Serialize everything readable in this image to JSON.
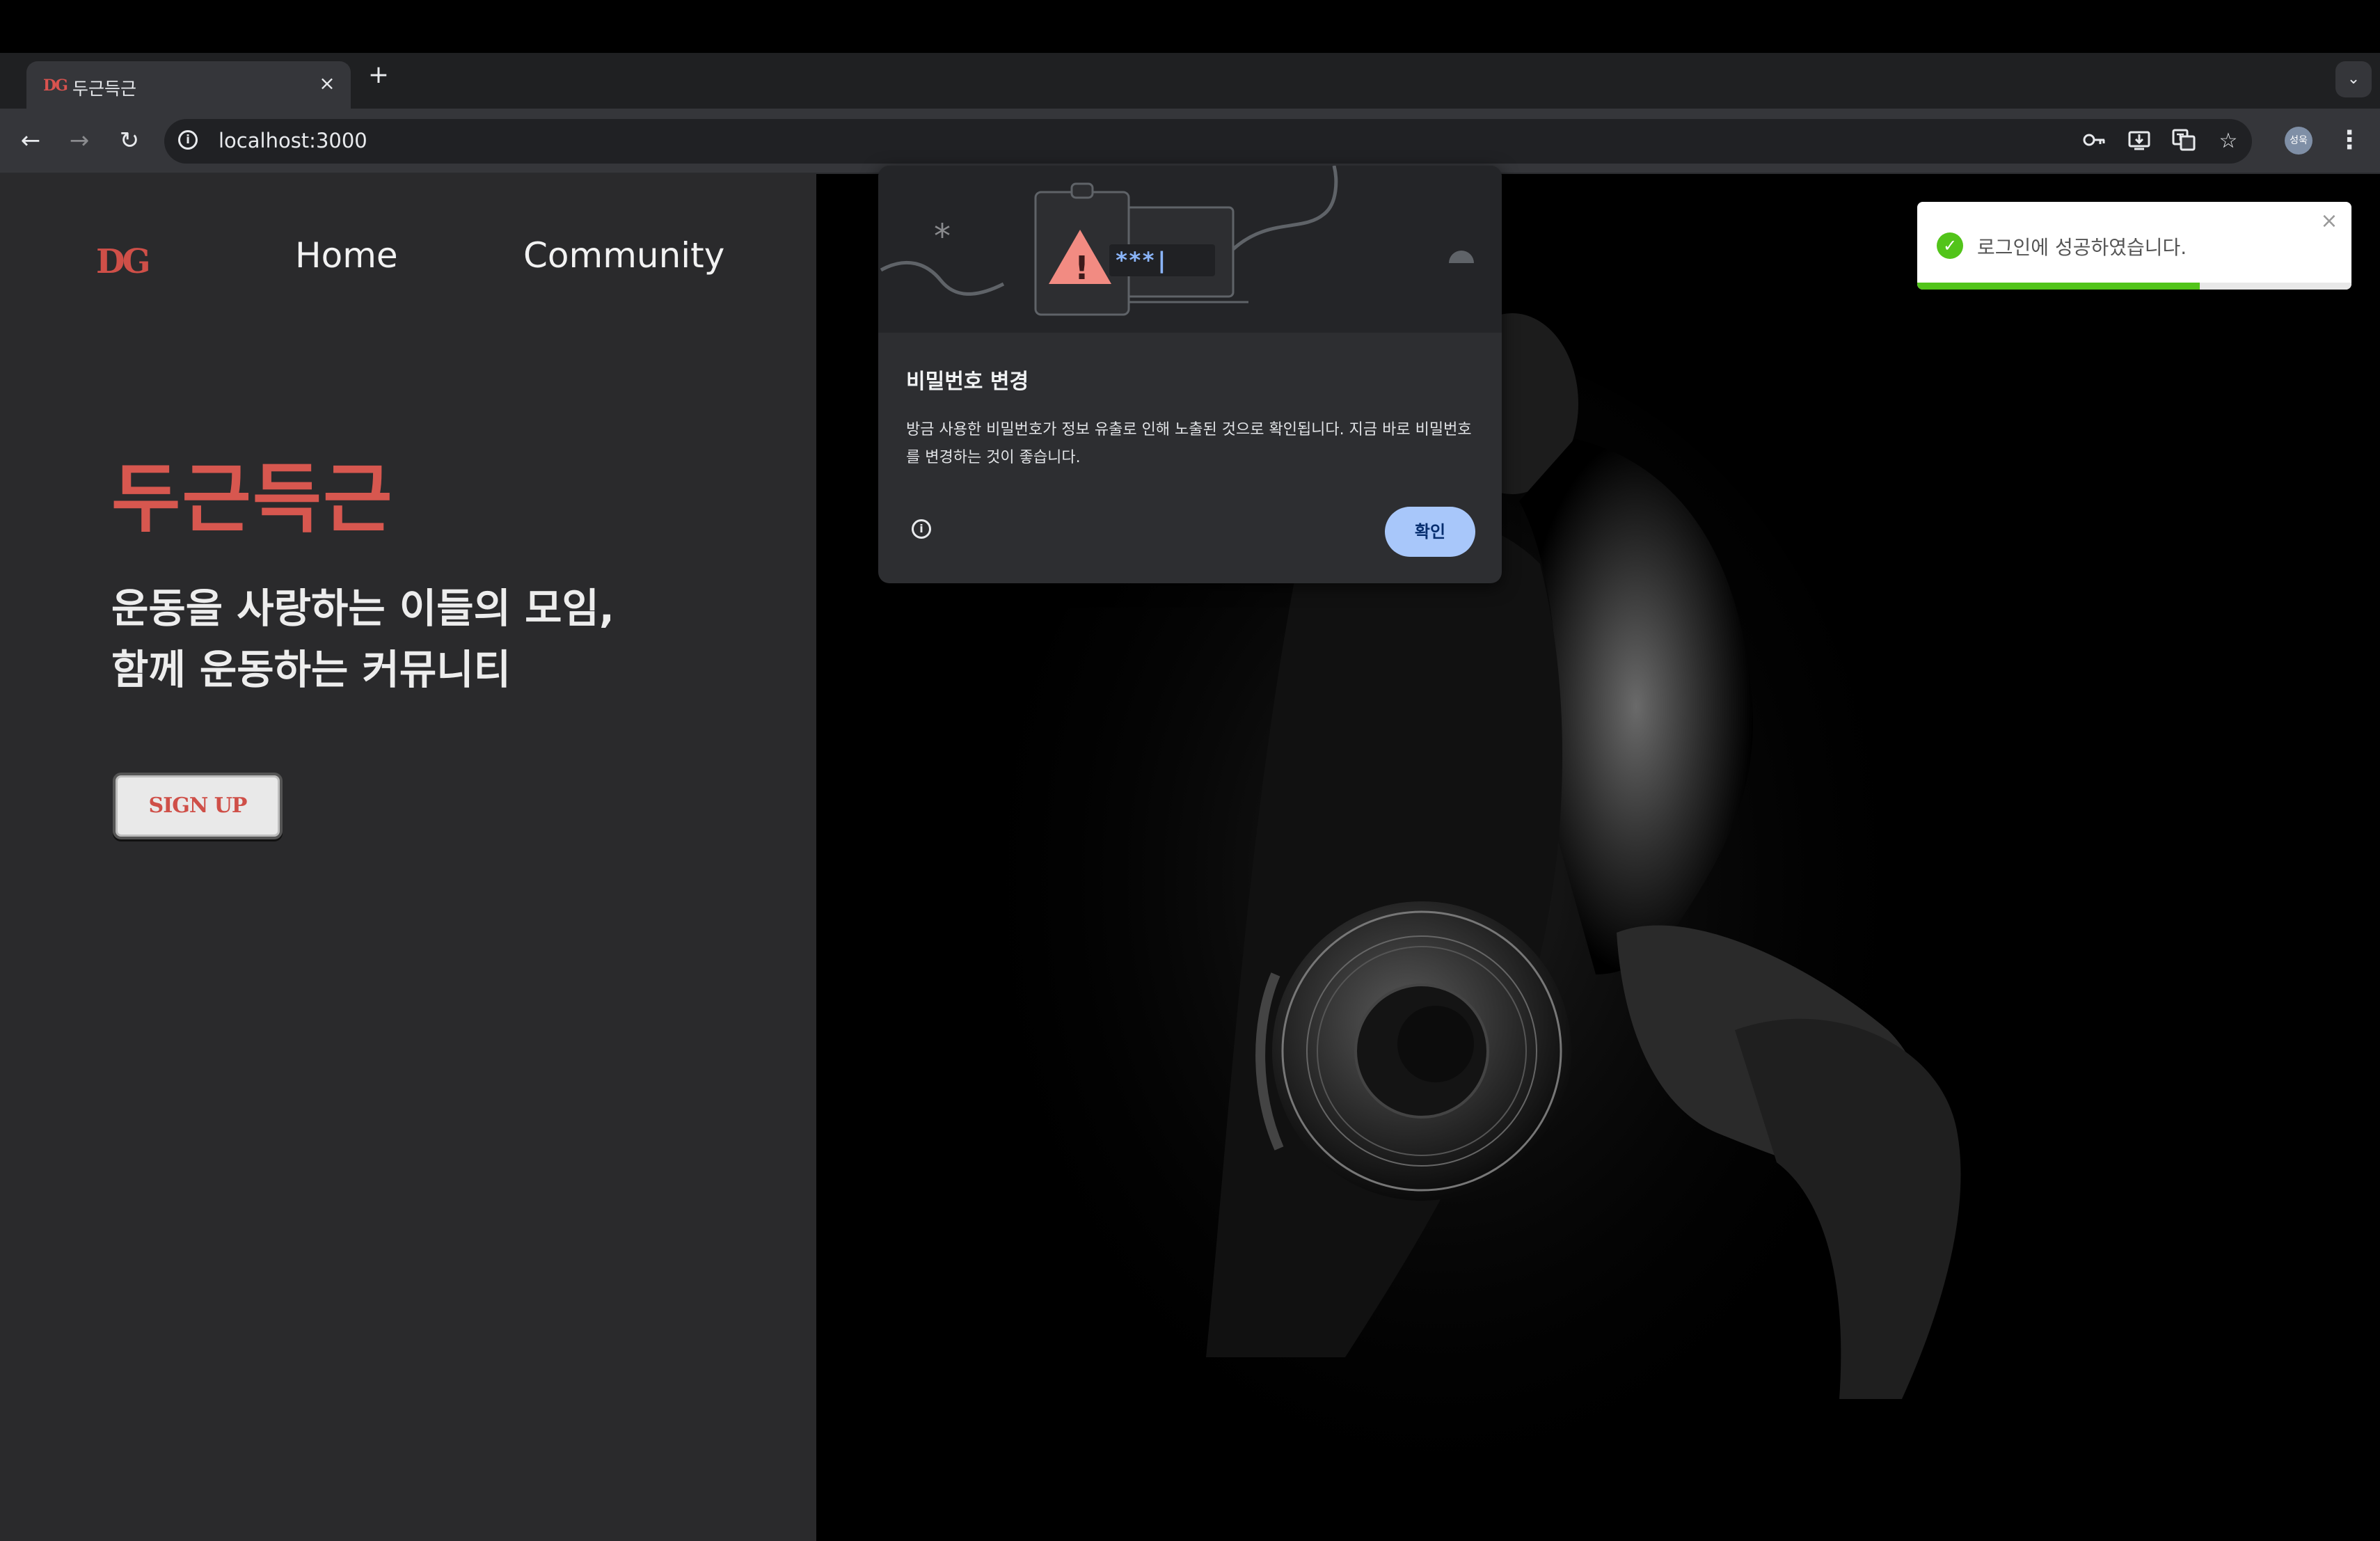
{
  "browser": {
    "tab": {
      "favicon": "DG",
      "title": "두근득근"
    },
    "new_tab": "+",
    "url": "localhost:3000",
    "icons": [
      "back-icon",
      "forward-icon",
      "reload-icon",
      "site-info-icon",
      "password-key-icon",
      "install-app-icon",
      "translate-icon",
      "bookmark-star-icon",
      "profile-avatar",
      "menu-icon",
      "tab-search-icon"
    ],
    "profile_initials": "성욱"
  },
  "site": {
    "logo": "DG",
    "nav": {
      "home": "Home",
      "community": "Community"
    },
    "hero_title": "두근득근",
    "hero_line1": "운동을 사랑하는 이들의 모임,",
    "hero_line2": "함께 운동하는 커뮤니티",
    "signup_label": "SIGN UP",
    "accent_color": "#d7574f"
  },
  "dialog": {
    "illus_password": "***|",
    "title": "비밀번호 변경",
    "body": "방금 사용한 비밀번호가 정보 유출로 인해 노출된 것으로 확인됩니다. 지금 바로 비밀번호를 변경하는 것이 좋습니다.",
    "ok_label": "확인"
  },
  "toast": {
    "message": "로그인에 성공하였습니다.",
    "progress": 0.65,
    "color": "#52c41a"
  }
}
